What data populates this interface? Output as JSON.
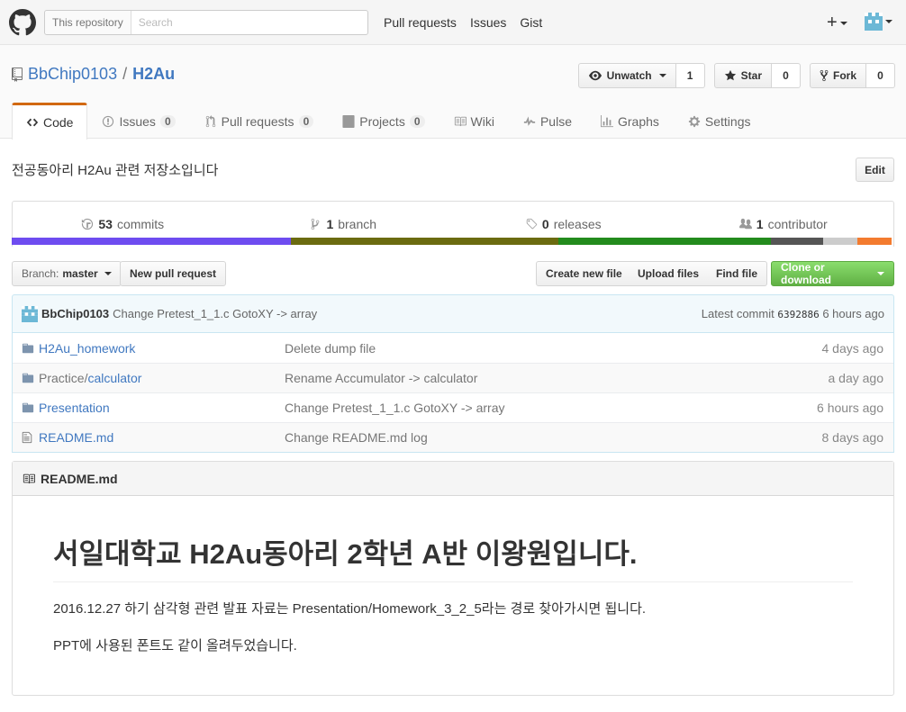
{
  "header": {
    "search_scope": "This repository",
    "search_placeholder": "Search",
    "nav": [
      "Pull requests",
      "Issues",
      "Gist"
    ],
    "plus": "+"
  },
  "repo": {
    "owner": "BbChip0103",
    "separator": "/",
    "name": "H2Au",
    "actions": {
      "watch_label": "Unwatch",
      "watch_count": "1",
      "star_label": "Star",
      "star_count": "0",
      "fork_label": "Fork",
      "fork_count": "0"
    },
    "tabs": [
      {
        "label": "Code",
        "count": null
      },
      {
        "label": "Issues",
        "count": "0"
      },
      {
        "label": "Pull requests",
        "count": "0"
      },
      {
        "label": "Projects",
        "count": "0"
      },
      {
        "label": "Wiki",
        "count": null
      },
      {
        "label": "Pulse",
        "count": null
      },
      {
        "label": "Graphs",
        "count": null
      },
      {
        "label": "Settings",
        "count": null
      }
    ],
    "description": "전공동아리 H2Au 관련 저장소입니다",
    "edit_label": "Edit"
  },
  "summary": {
    "commits_num": "53",
    "commits_label": "commits",
    "branch_num": "1",
    "branch_label": "branch",
    "releases_num": "0",
    "releases_label": "releases",
    "contributor_num": "1",
    "contributor_label": "contributor"
  },
  "language_colors": [
    "#6e4cf0",
    "#6b6b10",
    "#238b1d",
    "#555555",
    "#cccccc",
    "#f37b2f"
  ],
  "file_nav": {
    "branch_prefix": "Branch:",
    "branch_name": "master",
    "new_pr": "New pull request",
    "create_file": "Create new file",
    "upload_files": "Upload files",
    "find_file": "Find file",
    "clone": "Clone or download"
  },
  "latest_commit": {
    "author": "BbChip0103",
    "message": "Change Pretest_1_1.c GotoXY -> array",
    "prefix": "Latest commit",
    "sha": "6392886",
    "age": "6 hours ago"
  },
  "files": [
    {
      "type": "dir",
      "prefix": "",
      "name": "H2Au_homework",
      "message": "Delete dump file",
      "age": "4 days ago"
    },
    {
      "type": "dir",
      "prefix": "Practice/",
      "name": "calculator",
      "message": "Rename Accumulator -> calculator",
      "age": "a day ago"
    },
    {
      "type": "dir",
      "prefix": "",
      "name": "Presentation",
      "message": "Change Pretest_1_1.c GotoXY -> array",
      "age": "6 hours ago"
    },
    {
      "type": "file",
      "prefix": "",
      "name": "README.md",
      "message": "Change README.md log",
      "age": "8 days ago"
    }
  ],
  "readme": {
    "filename": "README.md",
    "heading": "서일대학교 H2Au동아리 2학년 A반 이왕원입니다.",
    "para1": "2016.12.27 하기 삼각형 관련 발표 자료는 Presentation/Homework_3_2_5라는 경로 찾아가시면 됩니다.",
    "para2": "PPT에 사용된 폰트도 같이 올려두었습니다."
  }
}
